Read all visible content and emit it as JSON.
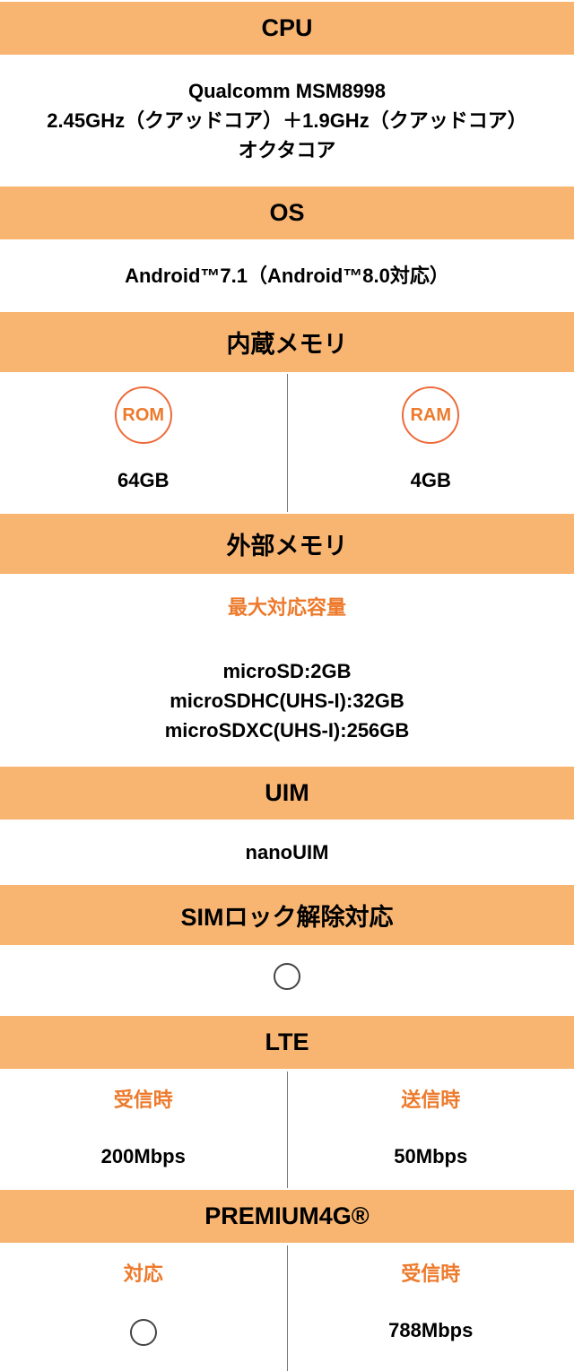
{
  "cpu": {
    "header": "CPU",
    "line1": "Qualcomm MSM8998",
    "line2": "2.45GHz（クアッドコア）＋1.9GHz（クアッドコア）",
    "line3": "オクタコア"
  },
  "os": {
    "header": "OS",
    "value": "Android™7.1（Android™8.0対応）"
  },
  "internal_memory": {
    "header": "内蔵メモリ",
    "rom_label": "ROM",
    "rom_value": "64GB",
    "ram_label": "RAM",
    "ram_value": "4GB"
  },
  "external_memory": {
    "header": "外部メモリ",
    "sub_label": "最大対応容量",
    "line1": "microSD:2GB",
    "line2": "microSDHC(UHS-I):32GB",
    "line3": "microSDXC(UHS-I):256GB"
  },
  "uim": {
    "header": "UIM",
    "value": "nanoUIM"
  },
  "sim_unlock": {
    "header": "SIMロック解除対応"
  },
  "lte": {
    "header": "LTE",
    "rx_label": "受信時",
    "rx_value": "200Mbps",
    "tx_label": "送信時",
    "tx_value": "50Mbps"
  },
  "premium4g": {
    "header": "PREMIUM4G®",
    "support_label": "対応",
    "rx_label": "受信時",
    "rx_value": "788Mbps"
  }
}
